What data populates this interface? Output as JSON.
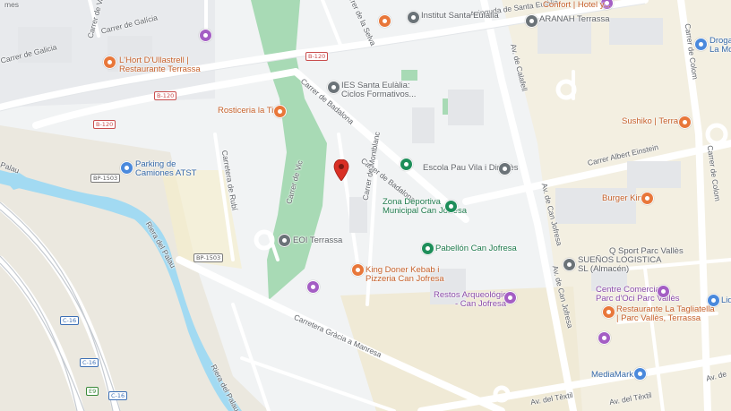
{
  "pois": [
    {
      "key": "hort",
      "text": "L'Hort D'Ullastrell |",
      "color": "orange"
    },
    {
      "key": "hort2",
      "text": "Restaurante Terrassa",
      "color": "orange"
    },
    {
      "key": "rosticeria",
      "text": "Rosticeria la Tieta",
      "color": "orange"
    },
    {
      "key": "parking",
      "text": "Parking de",
      "color": "blue"
    },
    {
      "key": "parking2",
      "text": "Camiones ATST",
      "color": "blue"
    },
    {
      "key": "institut",
      "text": "Institut Santa Eulàlia",
      "color": "grey"
    },
    {
      "key": "ies",
      "text": "IES Santa Eulàlia:",
      "color": "grey"
    },
    {
      "key": "ies2",
      "text": "Ciclos Formativos...",
      "color": "grey"
    },
    {
      "key": "aranah",
      "text": "ARANAH Terrassa",
      "color": "grey"
    },
    {
      "key": "escola",
      "text": "Escola Pau Vila i Dinarès",
      "color": "grey"
    },
    {
      "key": "zona",
      "text": "Zona Deportiva",
      "color": "green"
    },
    {
      "key": "zona2",
      "text": "Municipal Can Jofresa",
      "color": "green"
    },
    {
      "key": "pabellon",
      "text": "Pabellón Can Jofresa",
      "color": "green"
    },
    {
      "key": "eoi",
      "text": "EOI Terrassa",
      "color": "grey"
    },
    {
      "key": "king",
      "text": "King Doner Kebab i",
      "color": "orange"
    },
    {
      "key": "king2",
      "text": "Pizzeria Can Jofresa",
      "color": "orange"
    },
    {
      "key": "restos",
      "text": "Restos Arqueológicos",
      "color": "purple"
    },
    {
      "key": "restos2",
      "text": "- Can Jofresa",
      "color": "purple"
    },
    {
      "key": "sushiko",
      "text": "Sushiko | Terrassa",
      "color": "orange"
    },
    {
      "key": "burger",
      "text": "Burger King",
      "color": "orange"
    },
    {
      "key": "qsport",
      "text": "Q Sport Parc Vallès",
      "color": "grey"
    },
    {
      "key": "suenos",
      "text": "SUEÑOS LOGISTICA",
      "color": "grey"
    },
    {
      "key": "suenos2",
      "text": "SL (Almacén)",
      "color": "grey"
    },
    {
      "key": "centro",
      "text": "Centre Comercial i",
      "color": "purple"
    },
    {
      "key": "centro2",
      "text": "Parc d'Oci Parc Vallès",
      "color": "purple"
    },
    {
      "key": "lataglia",
      "text": "Restaurante La Tagliatella",
      "color": "orange"
    },
    {
      "key": "lataglia2",
      "text": "| Parc Vallès, Terrassa",
      "color": "orange"
    },
    {
      "key": "mediamarkt",
      "text": "MediaMarkt",
      "color": "blue"
    },
    {
      "key": "drogas",
      "text": "Drogas",
      "color": "blue"
    },
    {
      "key": "drogas2",
      "text": "La Mo",
      "color": "blue"
    },
    {
      "key": "lidl",
      "text": "Lid",
      "color": "blue"
    },
    {
      "key": "hotel",
      "text": "Confort | Hotel y...",
      "color": "orange"
    },
    {
      "key": "mes",
      "text": "mes",
      "color": "grey"
    }
  ],
  "streets": [
    {
      "key": "galicia",
      "text": "Carrer de Galícia"
    },
    {
      "key": "galicia2",
      "text": "Carrer de Galicia"
    },
    {
      "key": "valls",
      "text": "Carrer de Valls"
    },
    {
      "key": "selva",
      "text": "Carrer de la Selva"
    },
    {
      "key": "avsanta",
      "text": "Avinguda de Santa Eulàlia"
    },
    {
      "key": "badalona1",
      "text": "Carrer de Badalona"
    },
    {
      "key": "badalona2",
      "text": "Carrer de Badalona"
    },
    {
      "key": "montblanc",
      "text": "Carrer de Montblanc"
    },
    {
      "key": "vic",
      "text": "Carrer de Vic"
    },
    {
      "key": "rubi",
      "text": "Carretera de Rubí"
    },
    {
      "key": "manresa",
      "text": "Carretera Gràcia a Manresa"
    },
    {
      "key": "riera1",
      "text": "Riera del Palau"
    },
    {
      "key": "riera2",
      "text": "Riera del Palau"
    },
    {
      "key": "palau",
      "text": "Palau"
    },
    {
      "key": "calafell",
      "text": "Av. de Calafell"
    },
    {
      "key": "jofresa1",
      "text": "Av. de Can Jofresa"
    },
    {
      "key": "jofresa2",
      "text": "Av. de Can Jofresa"
    },
    {
      "key": "einstein",
      "text": "Carrer Albert Einstein"
    },
    {
      "key": "colom",
      "text": "Carrer de Colom"
    },
    {
      "key": "colom2",
      "text": "Carrer de Colom"
    },
    {
      "key": "textil",
      "text": "Av. del Tèxtil"
    },
    {
      "key": "textil2",
      "text": "Av. del Tèxtil"
    },
    {
      "key": "avde",
      "text": "Av. de"
    }
  ],
  "shields": [
    {
      "key": "b1",
      "text": "B-120"
    },
    {
      "key": "b2",
      "text": "B-120"
    },
    {
      "key": "b3",
      "text": "B-120"
    },
    {
      "key": "bp1",
      "text": "BP-1503"
    },
    {
      "key": "bp2",
      "text": "BP-1503"
    },
    {
      "key": "c1",
      "text": "C-16"
    },
    {
      "key": "c2",
      "text": "C-16"
    },
    {
      "key": "c3",
      "text": "C-16"
    },
    {
      "key": "e9",
      "text": "E9"
    }
  ],
  "colors": {
    "orange": "#e8773a",
    "green": "#1e8e5a",
    "purple": "#a45ec4",
    "grey": "#6b7378",
    "blue": "#4a89dc",
    "park": "#a8dab5",
    "water": "#a2daf2",
    "marker": "#d93025"
  },
  "selected_marker": "red-location-pin"
}
